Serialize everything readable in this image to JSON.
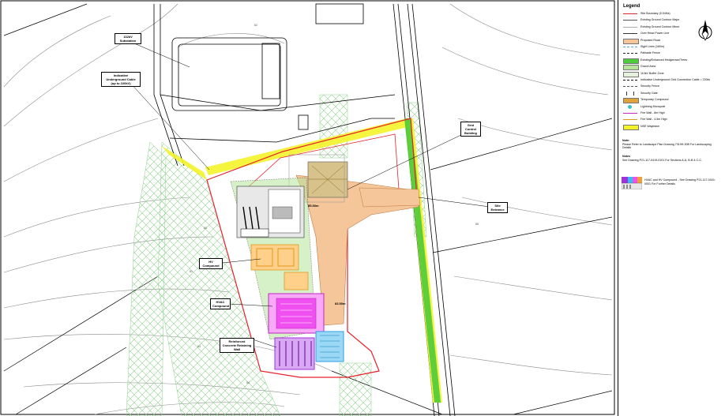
{
  "plan": {
    "contour_labels": [
      "82",
      "80",
      "81",
      "83",
      "84",
      "85"
    ],
    "callouts": {
      "substation": "132kV Substation",
      "cable": "Indicative Underground Cable (up to 220kV)",
      "control": "Grid Control Building",
      "entrance": "Site Entrance",
      "hv": "HV Compound",
      "hvac": "HVAC Compound",
      "wall": "Reinforced Concrete Retaining Wall"
    },
    "level_labels": [
      "85.50m",
      "83.50m"
    ]
  },
  "legend": {
    "title": "Legend",
    "items": [
      {
        "label": "Site Boundary (0.94Ha)",
        "style": "line",
        "color": "#e8202a"
      },
      {
        "label": "Existing Ground Contour Major",
        "style": "line",
        "color": "#555555"
      },
      {
        "label": "Existing Ground Contour Minor",
        "style": "line",
        "color": "#aaaaaa"
      },
      {
        "label": "Over Head Power Line",
        "style": "line",
        "color": "#333333"
      },
      {
        "label": "Proposed Road",
        "style": "fill",
        "color": "#f5c69a"
      },
      {
        "label": "Sight Lines (160m)",
        "style": "dash",
        "color": "#4aa6d8"
      },
      {
        "label": "Palisade Fence",
        "style": "dash",
        "color": "#222222"
      },
      {
        "label": "Existing/Enhanced Hedgerows/Trees",
        "style": "fill",
        "color": "#4ecb3a"
      },
      {
        "label": "Gravel Area",
        "style": "fill",
        "color": "#b6e49a"
      },
      {
        "label": "110kV Buffer Zone",
        "style": "fill",
        "color": "#e4f2dc"
      },
      {
        "label": "Indicative Underground Grid Connection Cable > 220kv",
        "style": "dash",
        "color": "#111111"
      },
      {
        "label": "Security Fence",
        "style": "dash",
        "color": "#555555"
      },
      {
        "label": "Security Gate",
        "style": "gate",
        "color": "#333333"
      },
      {
        "label": "Temporary Compound",
        "style": "fill",
        "color": "#e0a23a"
      },
      {
        "label": "Lightning Monopole",
        "style": "dot",
        "color": "#36c4c4"
      },
      {
        "label": "Fire Wall - 8m High",
        "style": "line",
        "color": "#c22ac2"
      },
      {
        "label": "Fire Wall - 4.5m High",
        "style": "line",
        "color": "#e09a1a"
      },
      {
        "label": "NSE Wayleave",
        "style": "fill",
        "color": "#f4f32a"
      }
    ],
    "note1_head": "Note:",
    "note1": "Please Refer to Landscape Plan Drawing 7319H-30B For Landscaping Details",
    "note2_head": "Notes",
    "note2": "See Drawing P21-117-0419-0101 For Sections A-A, B-B & C-C.",
    "note3": "HVAC and HV Compound - See Drawing P21-117-0419-0001 For Further Details"
  },
  "colors": {
    "boundary": "#e8202a",
    "road": "#f5c69a",
    "hedgerow": "#4ecb3a",
    "wayleave": "#f4f32a",
    "buffer": "#e4f2dc",
    "gravel": "#b6e49a",
    "hvac": "#f050f0",
    "battery": "#a030e0",
    "cyan": "#30c0f0",
    "temp": "#f0a030"
  }
}
